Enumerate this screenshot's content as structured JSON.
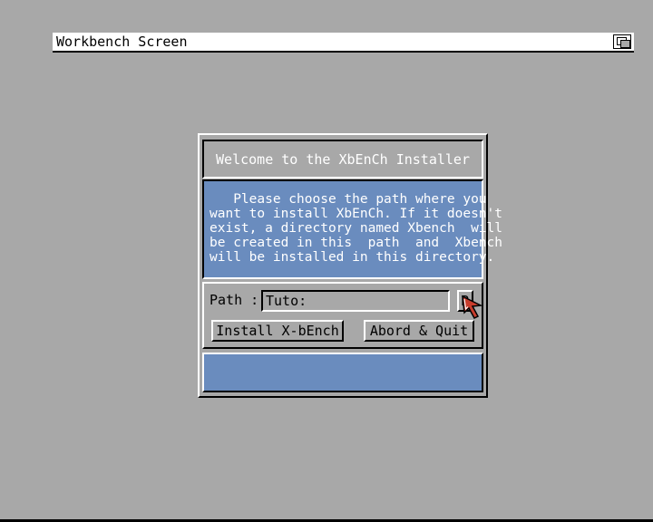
{
  "screen": {
    "title": "Workbench Screen"
  },
  "installer": {
    "title": "Welcome to the XbEnCh Installer",
    "info_lines": [
      "   Please choose the path where you",
      "want to install XbEnCh. If it doesn't",
      "exist, a directory named Xbench  will",
      "be created in this  path  and  Xbench",
      "will be installed in this directory."
    ],
    "path_label": "Path :",
    "path_value": "Tuto:",
    "browse_label": "P",
    "install_label": "Install X-bEnch",
    "quit_label": "Abord & Quit",
    "status": ""
  },
  "colors": {
    "background": "#a8a8a8",
    "panel_blue": "#6a8cbe",
    "highlight": "#ffffff",
    "shadow": "#000000",
    "pointer": "#c83c2c"
  },
  "icons": {
    "depth_gadget": "depth-gadget-icon",
    "pointer": "mouse-pointer-icon"
  }
}
